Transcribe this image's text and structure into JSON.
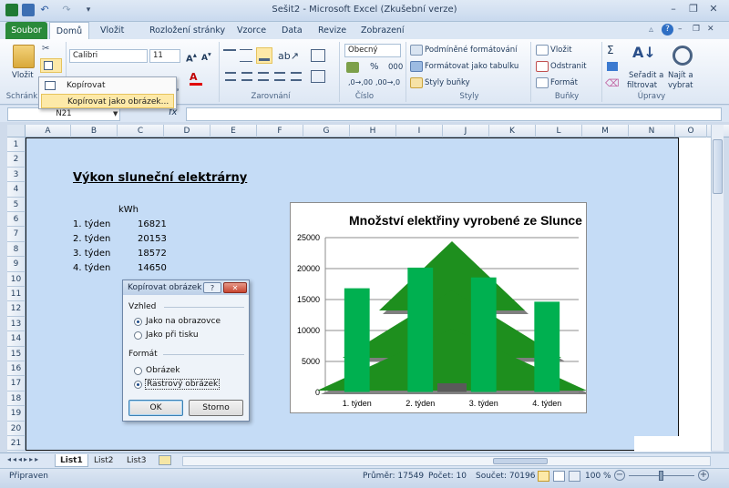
{
  "window": {
    "title": "Sešit2 - Microsoft Excel (Zkušební verze)",
    "controls": {
      "minimize": "–",
      "restore": "❐",
      "close": "✕"
    }
  },
  "tabs": [
    "Soubor",
    "Domů",
    "Vložit",
    "Rozložení stránky",
    "Vzorce",
    "Data",
    "Revize",
    "Zobrazení"
  ],
  "ribbon": {
    "clipboard": {
      "paste": "Vložit",
      "group_label": "Schránk"
    },
    "font": {
      "name": "Calibri",
      "size": "11",
      "bold": "B",
      "italic": "I",
      "underline": "U"
    },
    "alignment": {
      "group_label": "Zarovnání"
    },
    "number": {
      "format": "Obecný",
      "percent": "%",
      "thousands": "000",
      "group_label": "Číslo"
    },
    "styles": {
      "conditional": "Podmíněné formátování",
      "table": "Formátovat jako tabulku",
      "cell_styles": "Styly buňky",
      "group_label": "Styly"
    },
    "cells": {
      "insert": "Vložit",
      "delete": "Odstranit",
      "format": "Formát",
      "group_label": "Buňky"
    },
    "editing": {
      "sum": "Σ",
      "sort_filter": [
        "Seřadit a",
        "filtrovat"
      ],
      "find_select": [
        "Najít a",
        "vybrat"
      ],
      "group_label": "Úpravy"
    }
  },
  "paste_menu": {
    "items": [
      "Kopírovat",
      "Kopírovat jako obrázek..."
    ]
  },
  "formula_bar": {
    "name_box": "N21",
    "fx": "fx",
    "value": ""
  },
  "columns": [
    "A",
    "B",
    "C",
    "D",
    "E",
    "F",
    "G",
    "H",
    "I",
    "J",
    "K",
    "L",
    "M",
    "N",
    "O"
  ],
  "rows": [
    "1",
    "2",
    "3",
    "4",
    "5",
    "6",
    "7",
    "8",
    "9",
    "10",
    "11",
    "12",
    "13",
    "14",
    "15",
    "16",
    "17",
    "18",
    "19",
    "20",
    "21"
  ],
  "sheet": {
    "heading": "Výkon sluneční elektrárny",
    "unit": "kWh",
    "table": [
      {
        "week": "1. týden",
        "value": "16821"
      },
      {
        "week": "2. týden",
        "value": "20153"
      },
      {
        "week": "3. týden",
        "value": "18572"
      },
      {
        "week": "4. týden",
        "value": "14650"
      }
    ]
  },
  "chart_data": {
    "type": "bar",
    "title": "Množství elektřiny vyrobené ze Slunce",
    "categories": [
      "1. týden",
      "2. týden",
      "3. týden",
      "4. týden"
    ],
    "values": [
      16821,
      20153,
      18572,
      14650
    ],
    "ylim": [
      0,
      25000
    ],
    "yticks": [
      "0",
      "5000",
      "10000",
      "15000",
      "20000",
      "25000"
    ],
    "xlabel": "",
    "ylabel": "",
    "grid": true,
    "bar_color": "#00b050",
    "background_picture": "green-tree"
  },
  "dialog": {
    "title": "Kopírovat obrázek",
    "help": "?",
    "close": "✕",
    "appearance_label": "Vzhled",
    "appearance_options": [
      "Jako na obrazovce",
      "Jako při tisku"
    ],
    "appearance_selected": 0,
    "format_label": "Formát",
    "format_options": [
      "Obrázek",
      "Rastrový obrázek"
    ],
    "format_selected": 1,
    "ok": "OK",
    "cancel": "Storno"
  },
  "sheet_tabs": [
    "List1",
    "List2",
    "List3"
  ],
  "status": {
    "ready": "Připraven",
    "average": "Průměr: 17549",
    "count": "Počet: 10",
    "sum": "Součet: 70196",
    "zoom": "100 %"
  }
}
